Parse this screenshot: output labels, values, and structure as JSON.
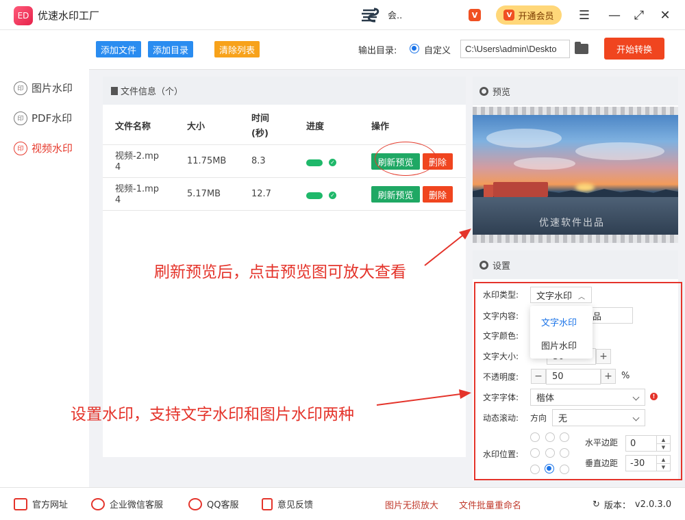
{
  "app": {
    "title": "优速水印工厂",
    "logo_text": "ED",
    "user_name": "会..",
    "vip_label": "开通会员",
    "vip_icon": "V"
  },
  "window": {
    "menu_icon": "☰",
    "minimize_icon": "—",
    "maximize_icon": "⤢",
    "close_icon": "✕"
  },
  "sidebar": {
    "items": [
      {
        "label": "图片水印",
        "icon": "印",
        "active": false
      },
      {
        "label": "PDF水印",
        "icon": "印",
        "active": false
      },
      {
        "label": "视频水印",
        "icon": "印",
        "active": true
      }
    ]
  },
  "toolbar": {
    "add_file": "添加文件",
    "add_folder": "添加目录",
    "clear_list": "清除列表",
    "output_label": "输出目录:",
    "output_option": "自定义",
    "output_path": "C:\\Users\\admin\\Deskto",
    "start": "开始转换"
  },
  "colors": {
    "primary_blue": "#1a73e8",
    "add_btn": "#2a8cf0",
    "clear_btn": "#f7a21b",
    "start_btn": "#f0451f",
    "refresh_btn": "#1fa864",
    "delete_btn": "#f0451f",
    "annotation_red": "#e4332a"
  },
  "file_panel": {
    "title": "文件信息（个）",
    "headers": {
      "name": "文件名称",
      "size": "大小",
      "time_line1": "时间",
      "time_line2": "(秒)",
      "progress": "进度",
      "action": "操作"
    },
    "rows": [
      {
        "name_line1": "视频-2.mp",
        "name_line2": "4",
        "size": "11.75MB",
        "time": "8.3",
        "progress": 1.0,
        "refresh": "刷新预览",
        "delete": "删除"
      },
      {
        "name_line1": "视频-1.mp",
        "name_line2": "4",
        "size": "5.17MB",
        "time": "12.7",
        "progress": 1.0,
        "refresh": "刷新预览",
        "delete": "删除"
      }
    ]
  },
  "preview": {
    "title": "预览",
    "watermark_text": "优速软件出品"
  },
  "settings": {
    "title": "设置",
    "watermark_type_label": "水印类型:",
    "watermark_type_value": "文字水印",
    "dropdown_options": [
      "文字水印",
      "图片水印"
    ],
    "text_content_label": "文字内容:",
    "text_content_value": "品",
    "text_color_label": "文字颜色:",
    "text_size_label": "文字大小:",
    "text_size_value": "30",
    "opacity_label": "不透明度:",
    "opacity_value": "50",
    "opacity_unit": "%",
    "font_label": "文字字体:",
    "font_value": "楷体",
    "scroll_label": "动态滚动:",
    "scroll_direction_label": "方向",
    "scroll_direction_value": "无",
    "position_label": "水印位置:",
    "position_selected_index": 7,
    "h_margin_label": "水平边距",
    "h_margin_value": "0",
    "v_margin_label": "垂直边距",
    "v_margin_value": "-30",
    "minus": "−",
    "plus": "+"
  },
  "annotations": {
    "preview_tip": "刷新预览后，点击预览图可放大查看",
    "settings_tip": "设置水印，支持文字水印和图片水印两种"
  },
  "statusbar": {
    "official_site": "官方网址",
    "wechat_service": "企业微信客服",
    "qq_service": "QQ客服",
    "feedback": "意见反馈",
    "lossless_enlarge": "图片无损放大",
    "batch_rename": "文件批量重命名",
    "version_label": "版本：",
    "version_value": "v2.0.3.0"
  }
}
